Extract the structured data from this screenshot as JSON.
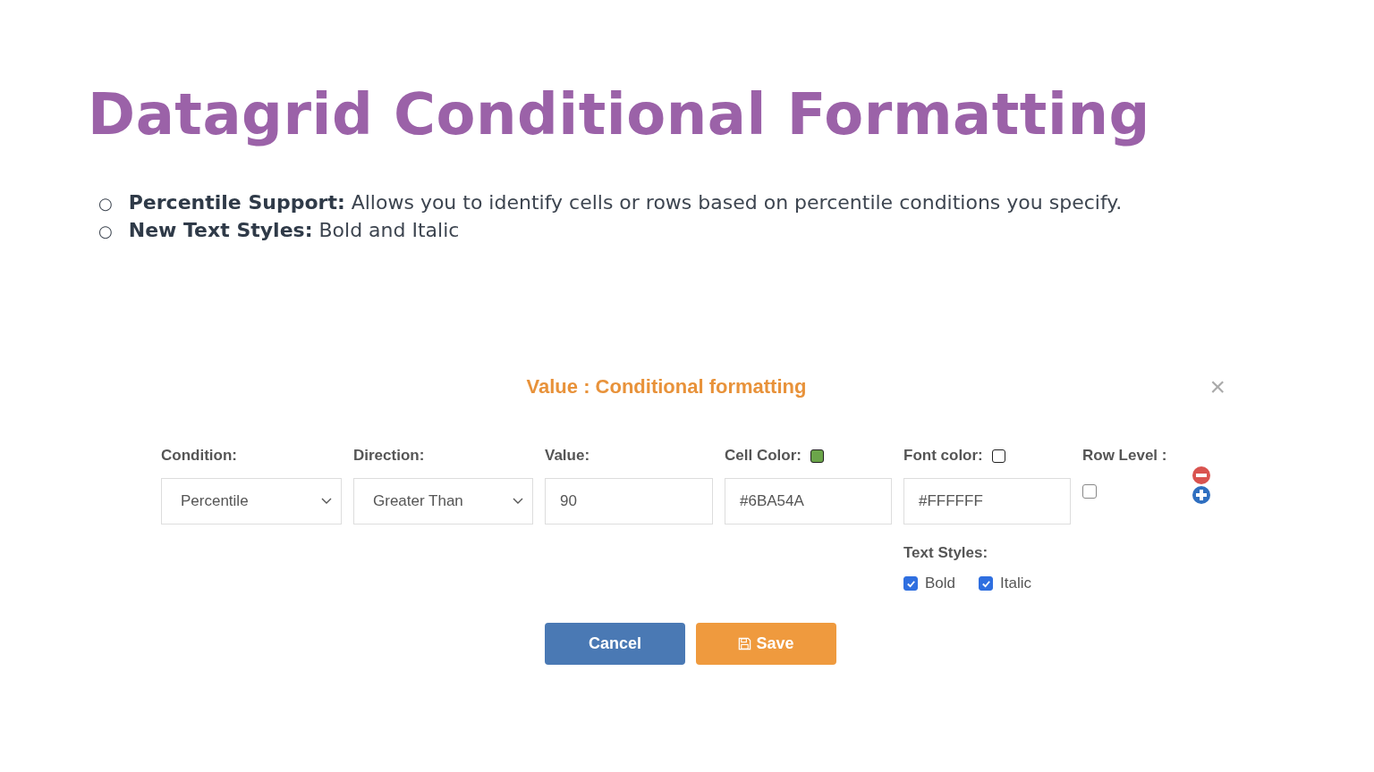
{
  "slide_title": "Datagrid Conditional Formatting",
  "bullets": [
    {
      "marker": "○",
      "text": "**Percentile Support:** Allows you to identify cells or rows based on percentile conditions you specify."
    },
    {
      "marker": "○",
      "text": "**New Text Styles:**  Bold and Italic"
    }
  ],
  "dialog": {
    "close": "×",
    "title": "Value : Conditional formatting",
    "fields": [
      {
        "kind": "select",
        "label": "Condition:",
        "value": "Percentile"
      },
      {
        "kind": "select",
        "label": "Direction:",
        "value": "Greater Than"
      },
      {
        "kind": "input",
        "label": "Value:",
        "value": "90"
      },
      {
        "kind": "color",
        "label": "Cell Color:",
        "value": "#6BA54A",
        "color": "#6ba54a"
      },
      {
        "kind": "color",
        "label": "Font color:",
        "value": "#FFFFFF",
        "color": "#ffffff"
      }
    ],
    "row_level": {
      "label": "Row Level :",
      "checked": false
    },
    "text_styles": {
      "label": "Text Styles:",
      "options": [
        {
          "label": "Bold",
          "checked": true
        },
        {
          "label": "Italic",
          "checked": true
        }
      ]
    },
    "buttons": [
      {
        "kind": "cancel",
        "label": "Cancel"
      },
      {
        "kind": "save",
        "label": "Save"
      }
    ]
  }
}
